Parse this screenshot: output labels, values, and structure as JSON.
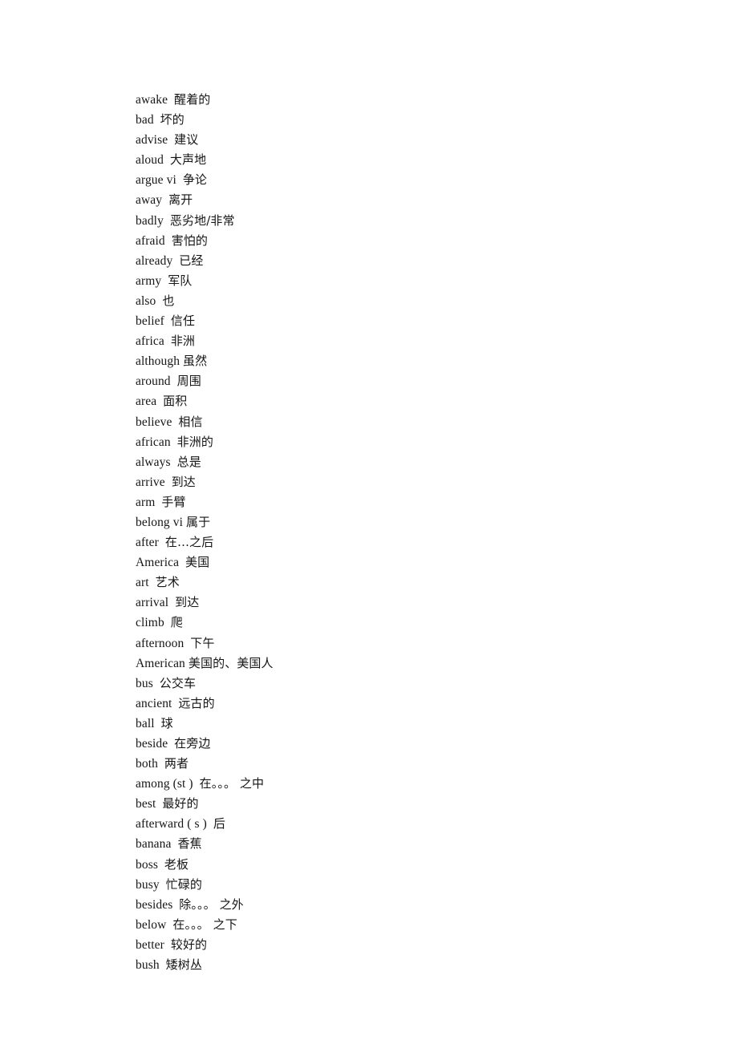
{
  "document": {
    "type": "vocabulary-list",
    "page_background": "#ffffff",
    "text_color": "#161616",
    "entry_count": 44
  },
  "entries": [
    {
      "term": "awake",
      "sep": "  ",
      "gloss": "醒着的"
    },
    {
      "term": "bad",
      "sep": "  ",
      "gloss": "坏的"
    },
    {
      "term": "advise",
      "sep": "  ",
      "gloss": "建议"
    },
    {
      "term": "aloud",
      "sep": "  ",
      "gloss": "大声地"
    },
    {
      "term": "argue vi",
      "sep": "  ",
      "gloss": "争论"
    },
    {
      "term": "away",
      "sep": "  ",
      "gloss": "离开"
    },
    {
      "term": "badly",
      "sep": "  ",
      "gloss": "恶劣地/非常"
    },
    {
      "term": "afraid",
      "sep": "  ",
      "gloss": "害怕的"
    },
    {
      "term": "already",
      "sep": "  ",
      "gloss": "已经"
    },
    {
      "term": "army",
      "sep": "  ",
      "gloss": "军队"
    },
    {
      "term": "also",
      "sep": "  ",
      "gloss": "也"
    },
    {
      "term": "belief",
      "sep": "  ",
      "gloss": "信任"
    },
    {
      "term": "africa",
      "sep": "  ",
      "gloss": "非洲"
    },
    {
      "term": "although",
      "sep": " ",
      "gloss": "虽然"
    },
    {
      "term": "around",
      "sep": "  ",
      "gloss": "周围"
    },
    {
      "term": "area",
      "sep": "  ",
      "gloss": "面积"
    },
    {
      "term": "believe",
      "sep": "  ",
      "gloss": "相信"
    },
    {
      "term": "african",
      "sep": "  ",
      "gloss": "非洲的"
    },
    {
      "term": "always",
      "sep": "  ",
      "gloss": "总是"
    },
    {
      "term": "arrive",
      "sep": "  ",
      "gloss": "到达"
    },
    {
      "term": "arm",
      "sep": "  ",
      "gloss": "手臂"
    },
    {
      "term": "belong vi",
      "sep": " ",
      "gloss": "属于"
    },
    {
      "term": "after",
      "sep": "  ",
      "gloss": "在…之后"
    },
    {
      "term": "America",
      "sep": "  ",
      "gloss": "美国"
    },
    {
      "term": "art",
      "sep": "  ",
      "gloss": "艺术"
    },
    {
      "term": "arrival",
      "sep": "  ",
      "gloss": "到达"
    },
    {
      "term": "climb",
      "sep": "  ",
      "gloss": "爬"
    },
    {
      "term": "afternoon",
      "sep": "  ",
      "gloss": "下午"
    },
    {
      "term": "American",
      "sep": " ",
      "gloss": "美国的、美国人"
    },
    {
      "term": "bus",
      "sep": "  ",
      "gloss": "公交车"
    },
    {
      "term": "ancient",
      "sep": "  ",
      "gloss": "远古的"
    },
    {
      "term": "ball",
      "sep": "  ",
      "gloss": "球"
    },
    {
      "term": "beside",
      "sep": "  ",
      "gloss": "在旁边"
    },
    {
      "term": "both",
      "sep": "  ",
      "gloss": "两者"
    },
    {
      "term": "among (st )",
      "sep": "  ",
      "gloss": "在。。。 之中"
    },
    {
      "term": "best",
      "sep": "  ",
      "gloss": "最好的"
    },
    {
      "term": "afterward ( s )",
      "sep": "  ",
      "gloss": "后"
    },
    {
      "term": "banana",
      "sep": "  ",
      "gloss": "香蕉"
    },
    {
      "term": "boss",
      "sep": "  ",
      "gloss": "老板"
    },
    {
      "term": "busy",
      "sep": "  ",
      "gloss": "忙碌的"
    },
    {
      "term": "besides",
      "sep": "  ",
      "gloss": "除。。。 之外"
    },
    {
      "term": "below",
      "sep": "  ",
      "gloss": "在。。。 之下"
    },
    {
      "term": "better",
      "sep": "  ",
      "gloss": "较好的"
    },
    {
      "term": "bush",
      "sep": "  ",
      "gloss": "矮树丛"
    }
  ]
}
